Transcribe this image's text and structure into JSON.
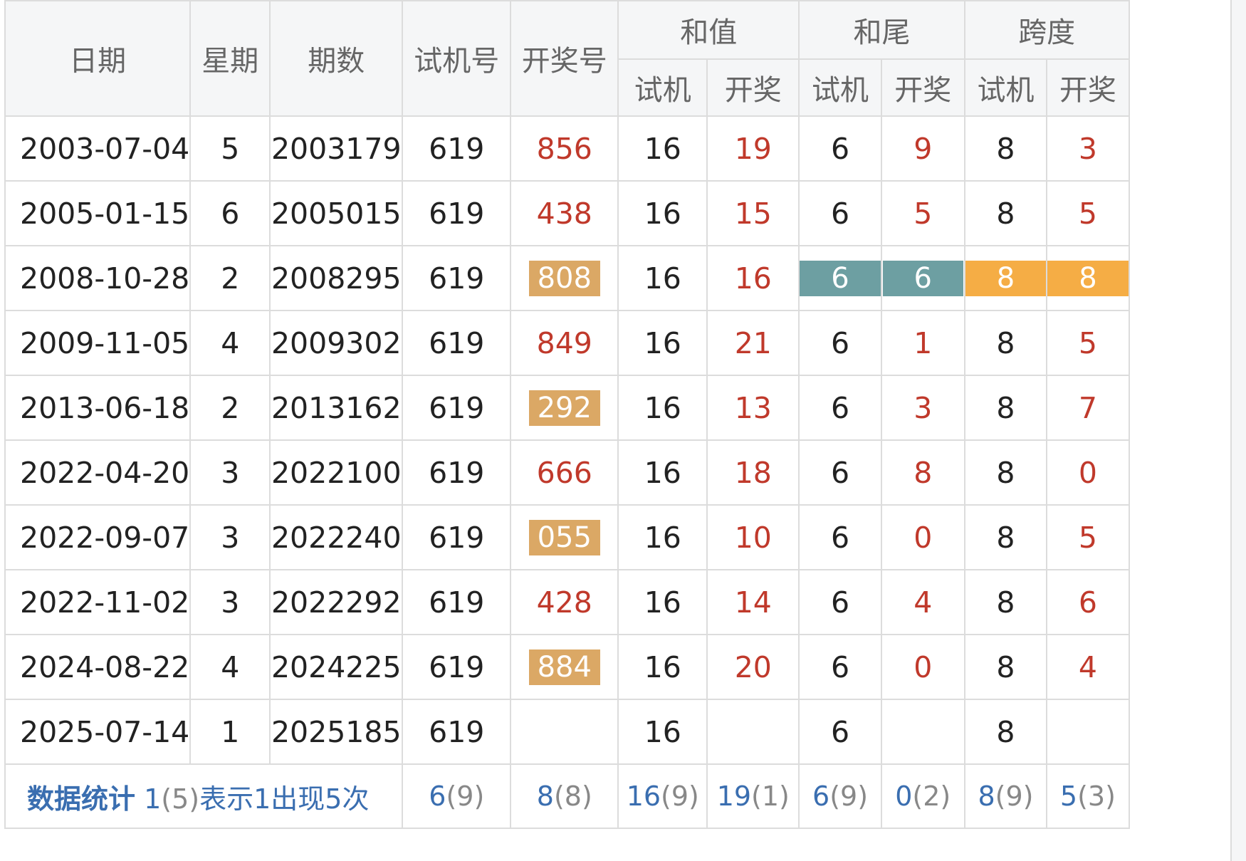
{
  "headers": {
    "date": "日期",
    "weekday": "星期",
    "issue": "期数",
    "trial": "试机号",
    "draw": "开奖号",
    "sum": "和值",
    "tail": "和尾",
    "span": "跨度",
    "sub_trial": "试机",
    "sub_draw": "开奖"
  },
  "colors": {
    "red": "#c0392b",
    "tan_badge": "#dba865",
    "teal_badge": "#6d9fa2",
    "orange_badge": "#f5ad45",
    "stat_blue": "#3a6eb0"
  },
  "rows": [
    {
      "date": "2003-07-04",
      "weekday": "5",
      "issue": "2003179",
      "trial": "619",
      "draw": "856",
      "sum_t": "16",
      "sum_d": "19",
      "tail_t": "6",
      "tail_d": "9",
      "span_t": "8",
      "span_d": "3"
    },
    {
      "date": "2005-01-15",
      "weekday": "6",
      "issue": "2005015",
      "trial": "619",
      "draw": "438",
      "sum_t": "16",
      "sum_d": "15",
      "tail_t": "6",
      "tail_d": "5",
      "span_t": "8",
      "span_d": "5"
    },
    {
      "date": "2008-10-28",
      "weekday": "2",
      "issue": "2008295",
      "trial": "619",
      "draw": "808",
      "sum_t": "16",
      "sum_d": "16",
      "tail_t": "6",
      "tail_d": "6",
      "span_t": "8",
      "span_d": "8"
    },
    {
      "date": "2009-11-05",
      "weekday": "4",
      "issue": "2009302",
      "trial": "619",
      "draw": "849",
      "sum_t": "16",
      "sum_d": "21",
      "tail_t": "6",
      "tail_d": "1",
      "span_t": "8",
      "span_d": "5"
    },
    {
      "date": "2013-06-18",
      "weekday": "2",
      "issue": "2013162",
      "trial": "619",
      "draw": "292",
      "sum_t": "16",
      "sum_d": "13",
      "tail_t": "6",
      "tail_d": "3",
      "span_t": "8",
      "span_d": "7"
    },
    {
      "date": "2022-04-20",
      "weekday": "3",
      "issue": "2022100",
      "trial": "619",
      "draw": "666",
      "sum_t": "16",
      "sum_d": "18",
      "tail_t": "6",
      "tail_d": "8",
      "span_t": "8",
      "span_d": "0"
    },
    {
      "date": "2022-09-07",
      "weekday": "3",
      "issue": "2022240",
      "trial": "619",
      "draw": "055",
      "sum_t": "16",
      "sum_d": "10",
      "tail_t": "6",
      "tail_d": "0",
      "span_t": "8",
      "span_d": "5"
    },
    {
      "date": "2022-11-02",
      "weekday": "3",
      "issue": "2022292",
      "trial": "619",
      "draw": "428",
      "sum_t": "16",
      "sum_d": "14",
      "tail_t": "6",
      "tail_d": "4",
      "span_t": "8",
      "span_d": "6"
    },
    {
      "date": "2024-08-22",
      "weekday": "4",
      "issue": "2024225",
      "trial": "619",
      "draw": "884",
      "sum_t": "16",
      "sum_d": "20",
      "tail_t": "6",
      "tail_d": "0",
      "span_t": "8",
      "span_d": "4"
    },
    {
      "date": "2025-07-14",
      "weekday": "1",
      "issue": "2025185",
      "trial": "619",
      "draw": "",
      "sum_t": "16",
      "sum_d": "",
      "tail_t": "6",
      "tail_d": "",
      "span_t": "8",
      "span_d": ""
    }
  ],
  "stats": {
    "title": "数据统计",
    "legend_num": "1",
    "legend_paren": "(5)",
    "legend_text": "表示1出现5次",
    "trial": {
      "num": "6",
      "paren": "(9)"
    },
    "draw": {
      "num": "8",
      "paren": "(8)"
    },
    "sum_t": {
      "num": "16",
      "paren": "(9)"
    },
    "sum_d": {
      "num": "19",
      "paren": "(1)"
    },
    "tail_t": {
      "num": "6",
      "paren": "(9)"
    },
    "tail_d": {
      "num": "0",
      "paren": "(2)"
    },
    "span_t": {
      "num": "8",
      "paren": "(9)"
    },
    "span_d": {
      "num": "5",
      "paren": "(3)"
    }
  }
}
